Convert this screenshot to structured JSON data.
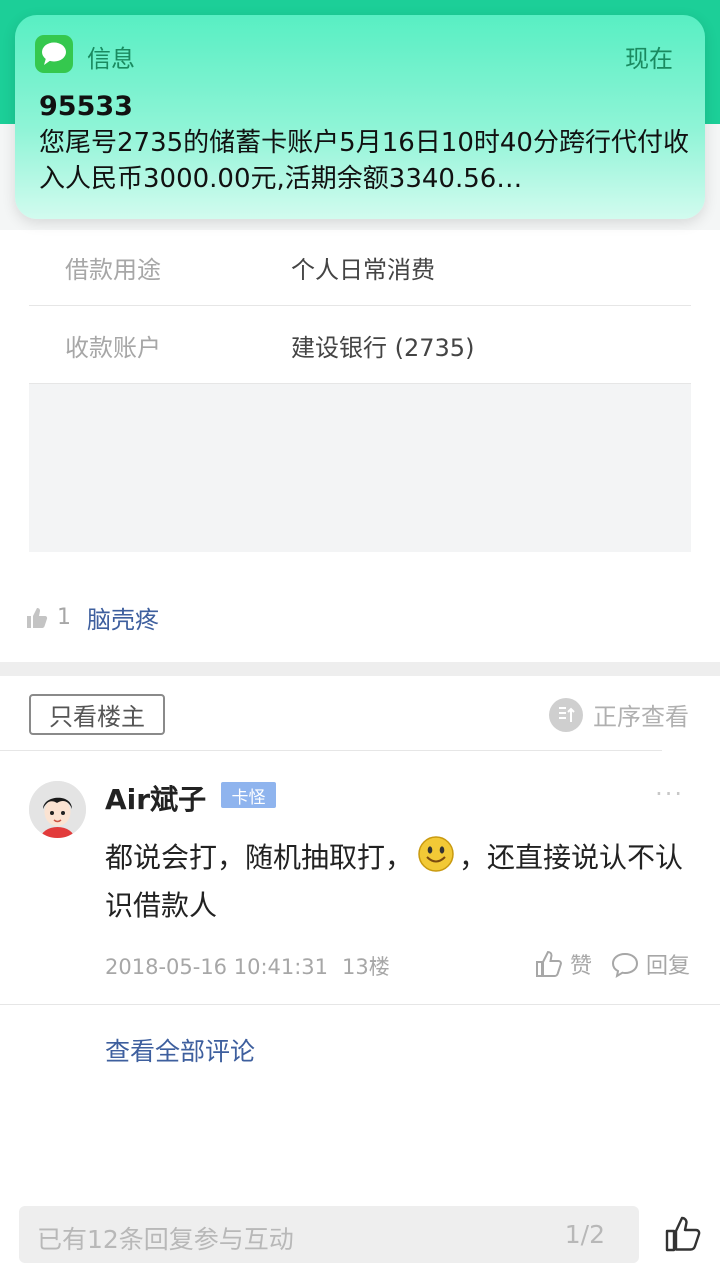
{
  "notification": {
    "app_name": "信息",
    "time": "现在",
    "sender": "95533",
    "body": "您尾号2735的储蓄卡账户5月16日10时40分跨行代付收入人民币3000.00元,活期余额3340.56…"
  },
  "details": [
    {
      "label": "借款用途",
      "value": "个人日常消费"
    },
    {
      "label": "收款账户",
      "value": "建设银行 (2735)"
    }
  ],
  "likes": {
    "count": "1",
    "user": "脑壳疼"
  },
  "filter": {
    "only_op": "只看楼主",
    "sort_label": "正序查看"
  },
  "comment": {
    "username": "Air斌子",
    "badge": "卡怪",
    "more": "···",
    "text_part1": "都说会打，随机抽取打，",
    "text_part2": "，还直接说认不认识借款人",
    "timestamp": "2018-05-16 10:41:31",
    "floor": "13楼",
    "like_label": "赞",
    "reply_label": "回复"
  },
  "view_all": "查看全部评论",
  "bottom": {
    "placeholder": "已有12条回复参与互动",
    "page": "1/2"
  }
}
